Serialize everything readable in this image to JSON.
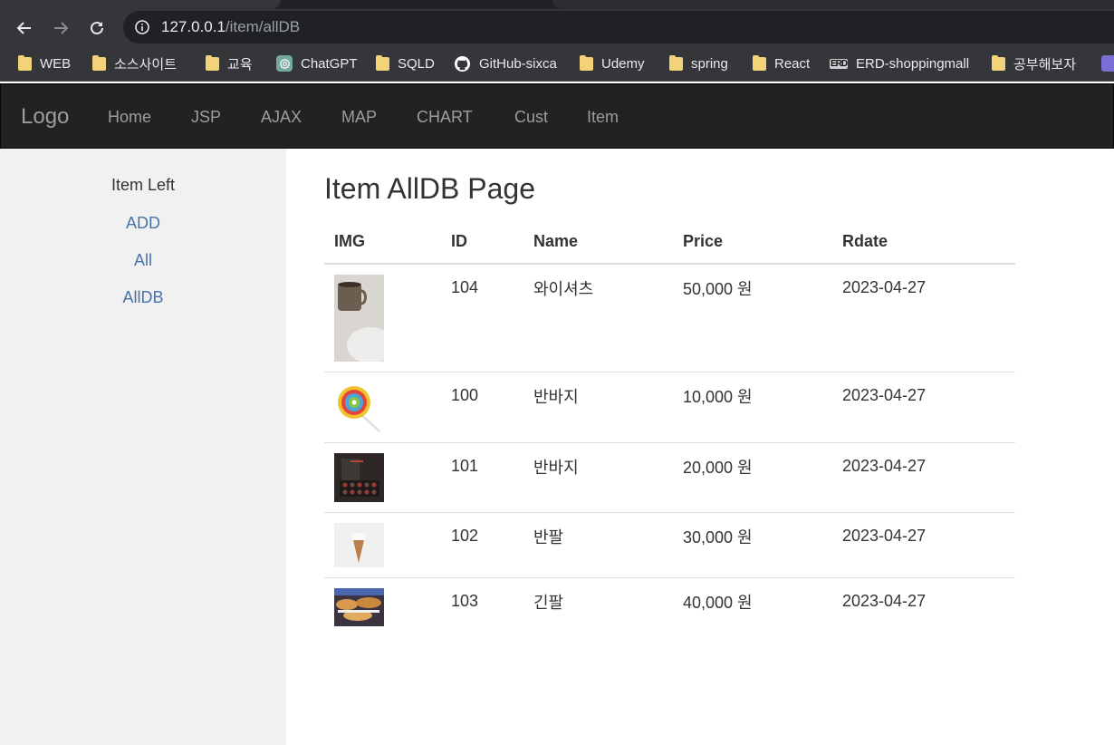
{
  "browser": {
    "url_host": "127.0.0.1",
    "url_path": "/item/allDB",
    "bookmarks": [
      {
        "label": "WEB",
        "icon": "folder-icon"
      },
      {
        "label": "소스사이트",
        "icon": "folder-icon"
      },
      {
        "label": "교육",
        "icon": "folder-icon"
      },
      {
        "label": "ChatGPT",
        "icon": "chatgpt-icon"
      },
      {
        "label": "SQLD",
        "icon": "folder-icon"
      },
      {
        "label": "GitHub-sixca",
        "icon": "github-icon"
      },
      {
        "label": "Udemy",
        "icon": "folder-icon"
      },
      {
        "label": "spring",
        "icon": "folder-icon"
      },
      {
        "label": "React",
        "icon": "folder-icon"
      },
      {
        "label": "ERD-shoppingmall",
        "icon": "erd-icon"
      },
      {
        "label": "공부해보자",
        "icon": "folder-icon"
      }
    ]
  },
  "navbar": {
    "brand": "Logo",
    "links": [
      "Home",
      "JSP",
      "AJAX",
      "MAP",
      "CHART",
      "Cust",
      "Item"
    ]
  },
  "sidebar": {
    "title": "Item Left",
    "links": [
      "ADD",
      "All",
      "AllDB"
    ]
  },
  "main": {
    "title": "Item AllDB Page",
    "columns": [
      "IMG",
      "ID",
      "Name",
      "Price",
      "Rdate"
    ],
    "rows": [
      {
        "img": "coffee-mug-image",
        "id": "104",
        "name": "와이셔츠",
        "price": "50,000 원",
        "rdate": "2023-04-27"
      },
      {
        "img": "lollipop-image",
        "id": "100",
        "name": "반바지",
        "price": "10,000 원",
        "rdate": "2023-04-27"
      },
      {
        "img": "chocolate-box-image",
        "id": "101",
        "name": "반바지",
        "price": "20,000 원",
        "rdate": "2023-04-27"
      },
      {
        "img": "ice-cream-cone-image",
        "id": "102",
        "name": "반팔",
        "price": "30,000 원",
        "rdate": "2023-04-27"
      },
      {
        "img": "pancakes-image",
        "id": "103",
        "name": "긴팔",
        "price": "40,000 원",
        "rdate": "2023-04-27"
      }
    ]
  },
  "colors": {
    "navbar_bg": "#222222",
    "nav_text": "#9d9d9d",
    "sidebar_bg": "#f1f1f1",
    "link": "#4a72a8",
    "chrome_bg": "#35363a"
  }
}
